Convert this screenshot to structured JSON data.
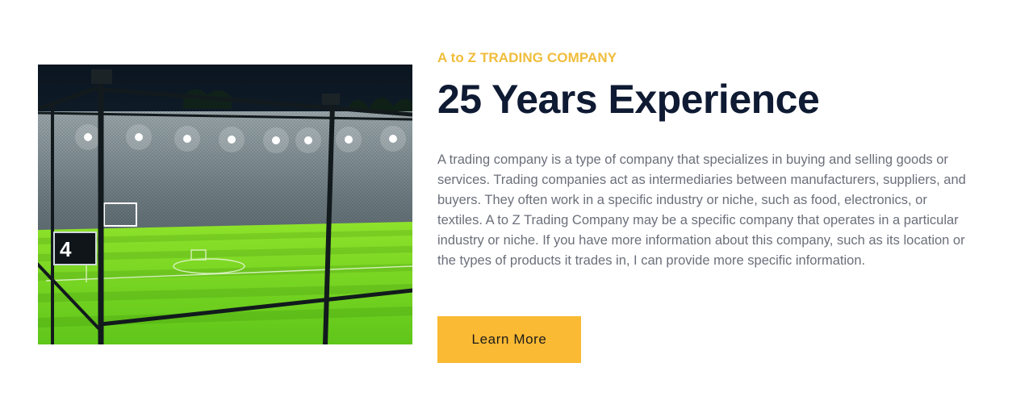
{
  "image": {
    "icon": "football-turf-image",
    "scoreboard_number": "4"
  },
  "section": {
    "eyebrow": "A to Z TRADING COMPANY",
    "title": "25 Years Experience",
    "description": "A trading company is a type of company that specializes in buying and selling goods or services. Trading companies act as intermediaries between manufacturers, suppliers, and buyers. They often work in a specific industry or niche, such as food, electronics, or textiles. A to Z Trading Company may be a specific company that operates in a particular industry or niche. If you have more information about this company, such as its location or the types of products it trades in, I can provide more specific information.",
    "button_label": "Learn More"
  },
  "colors": {
    "accent": "#fbba33",
    "eyebrow": "#f0bd3b",
    "title": "#0f1a33",
    "body_text": "#6b6f7a",
    "turf": "#7ed321"
  }
}
